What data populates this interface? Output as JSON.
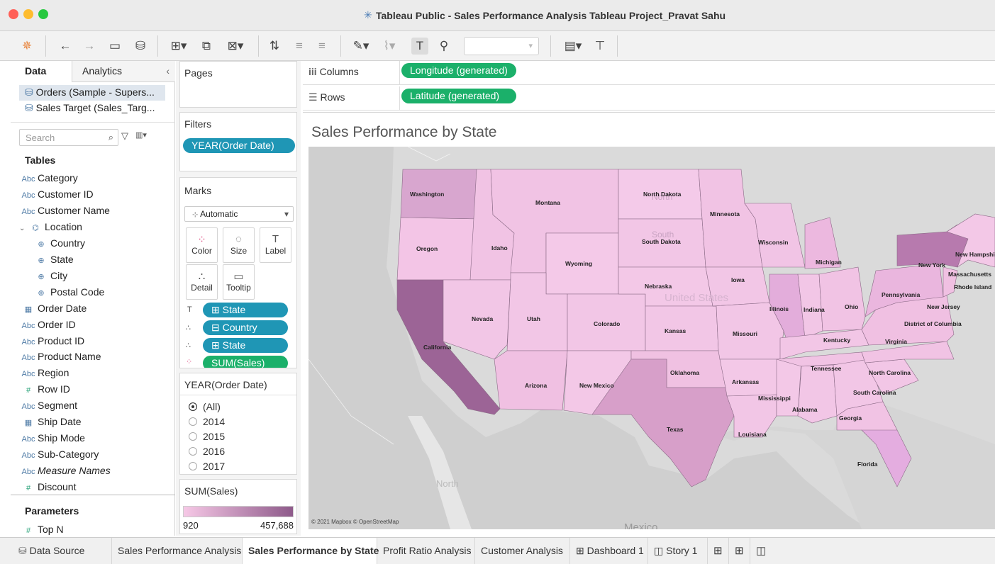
{
  "window": {
    "title": "Tableau Public - Sales Performance Analysis Tableau Project_Pravat Sahu"
  },
  "datapane": {
    "tab_data": "Data",
    "tab_analytics": "Analytics",
    "datasources": [
      "Orders (Sample - Supers...",
      "Sales Target (Sales_Targ..."
    ],
    "search_placeholder": "Search",
    "tables_header": "Tables",
    "fields": [
      {
        "type": "Abc",
        "name": "Category"
      },
      {
        "type": "Abc",
        "name": "Customer ID"
      },
      {
        "type": "Abc",
        "name": "Customer Name"
      },
      {
        "type": "hier",
        "name": "Location"
      },
      {
        "type": "geo",
        "name": "Country"
      },
      {
        "type": "geo",
        "name": "State"
      },
      {
        "type": "geo",
        "name": "City"
      },
      {
        "type": "geo",
        "name": "Postal Code"
      },
      {
        "type": "date",
        "name": "Order Date"
      },
      {
        "type": "Abc",
        "name": "Order ID"
      },
      {
        "type": "Abc",
        "name": "Product ID"
      },
      {
        "type": "Abc",
        "name": "Product Name"
      },
      {
        "type": "Abc",
        "name": "Region"
      },
      {
        "type": "#",
        "name": "Row ID"
      },
      {
        "type": "Abc",
        "name": "Segment"
      },
      {
        "type": "date",
        "name": "Ship Date"
      },
      {
        "type": "Abc",
        "name": "Ship Mode"
      },
      {
        "type": "Abc",
        "name": "Sub-Category"
      },
      {
        "type": "Abc",
        "name": "Measure Names"
      },
      {
        "type": "#",
        "name": "Discount"
      }
    ],
    "parameters_header": "Parameters",
    "parameters": [
      {
        "type": "#",
        "name": "Top N"
      }
    ]
  },
  "pages": {
    "label": "Pages"
  },
  "filters": {
    "label": "Filters",
    "items": [
      "YEAR(Order Date)"
    ]
  },
  "marks": {
    "label": "Marks",
    "type": "Automatic",
    "buttons": [
      "Color",
      "Size",
      "Label",
      "Detail",
      "Tooltip"
    ],
    "fields": [
      {
        "icon": "label",
        "name": "⊞ State"
      },
      {
        "icon": "detail",
        "name": "⊟ Country"
      },
      {
        "icon": "detail",
        "name": "⊞ State"
      },
      {
        "icon": "color",
        "name": "SUM(Sales)"
      }
    ]
  },
  "year_filter": {
    "label": "YEAR(Order Date)",
    "options": [
      "(All)",
      "2014",
      "2015",
      "2016",
      "2017"
    ],
    "selected": "(All)"
  },
  "legend": {
    "label": "SUM(Sales)",
    "min": "920",
    "max": "457,688",
    "color_low": "#f6c8e6",
    "color_high": "#8e5a8a"
  },
  "shelves": {
    "columns_label": "Columns",
    "columns_pill": "Longitude (generated)",
    "rows_label": "Rows",
    "rows_pill": "Latitude (generated)"
  },
  "view": {
    "title": "Sales Performance by State",
    "attribution": "© 2021 Mapbox © OpenStreetMap",
    "basemap_labels": [
      "North",
      "South",
      "United States",
      "Mexico"
    ],
    "states": [
      "Washington",
      "Oregon",
      "California",
      "Idaho",
      "Nevada",
      "Montana",
      "Wyoming",
      "Utah",
      "Arizona",
      "Colorado",
      "New Mexico",
      "North Dakota",
      "South Dakota",
      "Nebraska",
      "Kansas",
      "Oklahoma",
      "Texas",
      "Minnesota",
      "Iowa",
      "Missouri",
      "Arkansas",
      "Louisiana",
      "Wisconsin",
      "Illinois",
      "Mississippi",
      "Michigan",
      "Indiana",
      "Kentucky",
      "Tennessee",
      "Alabama",
      "Ohio",
      "Georgia",
      "Florida",
      "South Carolina",
      "North Carolina",
      "Virginia",
      "Pennsylvania",
      "New York",
      "New Jersey",
      "District of Columbia",
      "Massachusetts",
      "Rhode Island",
      "New Hampshire"
    ]
  },
  "bottom_tabs": [
    "Data Source",
    "Sales Performance Analysis",
    "Sales Performance by State",
    "Profit Ratio Analysis",
    "Customer Analysis",
    "⊞ Dashboard 1",
    "◫ Story 1"
  ],
  "active_tab": "Sales Performance by State"
}
